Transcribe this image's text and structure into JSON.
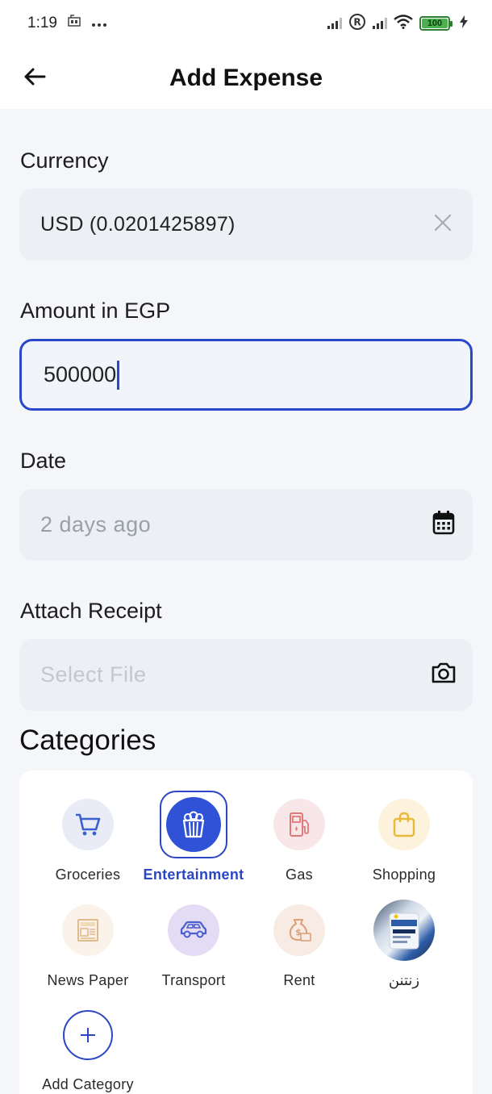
{
  "status_bar": {
    "time": "1:19",
    "battery": "100",
    "icons": [
      "sim-card-icon",
      "more-dots-icon",
      "signal-icon",
      "registered-icon",
      "signal-icon",
      "wifi-icon",
      "battery-icon",
      "charging-icon"
    ]
  },
  "app_bar": {
    "title": "Add Expense",
    "back_icon": "arrow-left-icon"
  },
  "form": {
    "currency": {
      "label": "Currency",
      "value": "USD (0.0201425897)",
      "clear_icon": "close-icon"
    },
    "amount": {
      "label": "Amount in EGP",
      "value": "500000"
    },
    "date": {
      "label": "Date",
      "placeholder": "2 days ago",
      "icon": "calendar-icon"
    },
    "receipt": {
      "label": "Attach Receipt",
      "placeholder": "Select File",
      "icon": "camera-icon"
    }
  },
  "categories": {
    "title": "Categories",
    "items": [
      {
        "label": "Groceries",
        "icon": "shopping-cart-icon",
        "color": "#3a5fcf",
        "bg": "#e9ecf7",
        "selected": false
      },
      {
        "label": "Entertainment",
        "icon": "popcorn-icon",
        "color": "#ffffff",
        "bg": "#2f52d6",
        "selected": true
      },
      {
        "label": "Gas",
        "icon": "gas-pump-icon",
        "color": "#e07a7a",
        "bg": "#f8e6e8",
        "selected": false
      },
      {
        "label": "Shopping",
        "icon": "shopping-bag-icon",
        "color": "#e8b93a",
        "bg": "#fdf2dc",
        "selected": false
      },
      {
        "label": "News Paper",
        "icon": "newspaper-icon",
        "color": "#e2b98a",
        "bg": "#fbf3ea",
        "selected": false
      },
      {
        "label": "Transport",
        "icon": "car-icon",
        "color": "#4a5fc9",
        "bg": "#e4dbf4",
        "selected": false
      },
      {
        "label": "Rent",
        "icon": "money-bag-icon",
        "color": "#d9a07a",
        "bg": "#f7ebe4",
        "selected": false
      },
      {
        "label": "زنتنن",
        "icon": "custom-photo-icon",
        "color": "#2d5da8",
        "bg": "#cfd9e6",
        "selected": false
      }
    ],
    "add_label": "Add Category",
    "add_icon": "plus-icon"
  }
}
